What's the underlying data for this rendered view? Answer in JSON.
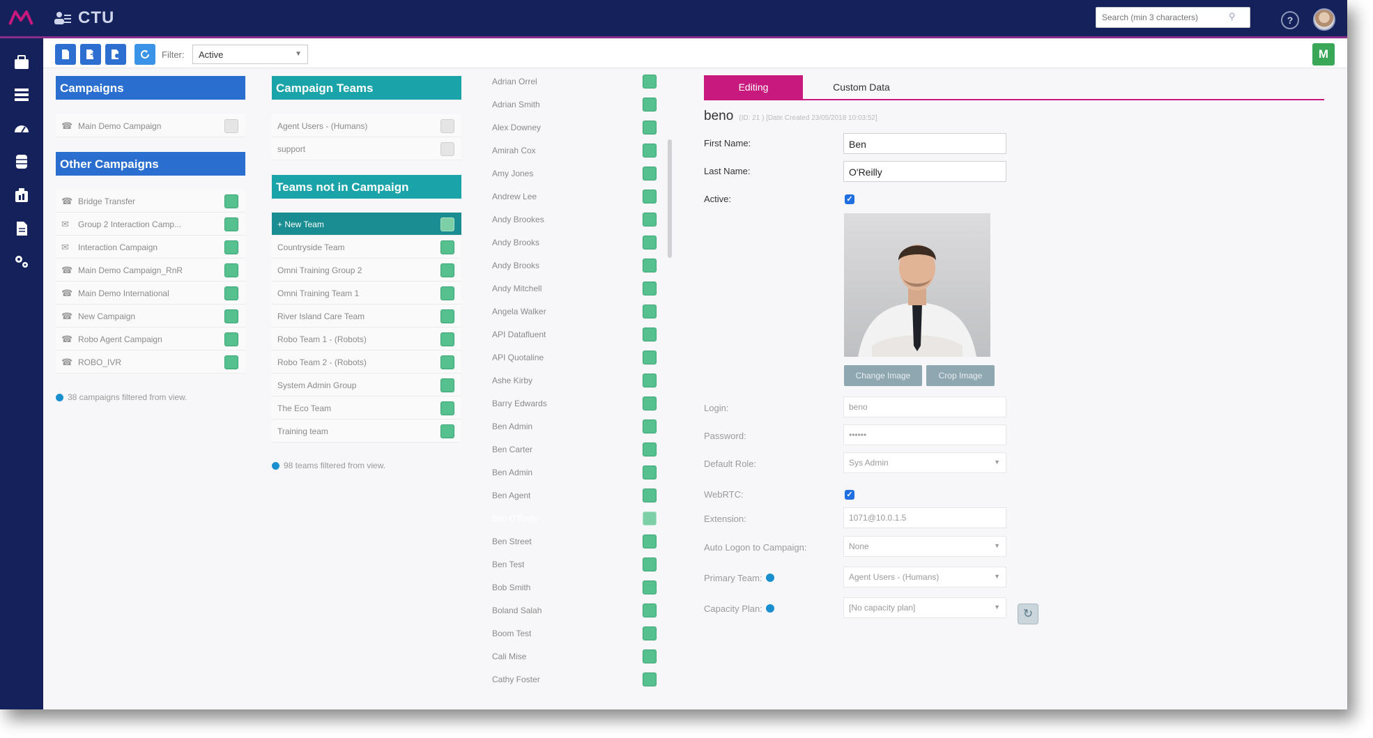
{
  "app": {
    "title": "CTU",
    "search_placeholder": "Search (min 3 characters)"
  },
  "toolbar": {
    "filter_label": "Filter:",
    "filter_value": "Active"
  },
  "campaigns": {
    "header": "Campaigns",
    "items": [
      {
        "label": "Main Demo Campaign",
        "icon": "phone-icon"
      }
    ]
  },
  "other_campaigns": {
    "header": "Other Campaigns",
    "items": [
      {
        "label": "Bridge Transfer",
        "icon": "phone-icon"
      },
      {
        "label": "Group 2 Interaction Camp...",
        "icon": "chat-icon"
      },
      {
        "label": "Interaction Campaign",
        "icon": "chat-icon"
      },
      {
        "label": "Main Demo Campaign_RnR",
        "icon": "phone-icon"
      },
      {
        "label": "Main Demo International",
        "icon": "phone-icon"
      },
      {
        "label": "New Campaign",
        "icon": "phone-icon"
      },
      {
        "label": "Robo Agent Campaign",
        "icon": "phone-icon"
      },
      {
        "label": "ROBO_IVR",
        "icon": "phone-icon"
      }
    ],
    "footnote": "38 campaigns filtered from view."
  },
  "campaign_teams": {
    "header": "Campaign Teams",
    "items": [
      {
        "label": "Agent Users - (Humans)"
      },
      {
        "label": "support"
      }
    ]
  },
  "teams_not_in_campaign": {
    "header": "Teams not in Campaign",
    "items": [
      {
        "label": "+ New Team"
      },
      {
        "label": "Countryside Team"
      },
      {
        "label": "Omni Training Group 2"
      },
      {
        "label": "Omni Training Team 1"
      },
      {
        "label": "River Island Care Team"
      },
      {
        "label": "Robo Team 1 - (Robots)"
      },
      {
        "label": "Robo Team 2 - (Robots)"
      },
      {
        "label": "System Admin Group"
      },
      {
        "label": "The Eco Team"
      },
      {
        "label": "Training team"
      }
    ],
    "footnote": "98 teams filtered from view."
  },
  "users": {
    "items": [
      {
        "label": "Adrian Orrel"
      },
      {
        "label": "Adrian Smith"
      },
      {
        "label": "Alex Downey"
      },
      {
        "label": "Amirah Cox"
      },
      {
        "label": "Amy Jones"
      },
      {
        "label": "Andrew Lee"
      },
      {
        "label": "Andy Brookes"
      },
      {
        "label": "Andy Brooks"
      },
      {
        "label": "Andy Brooks"
      },
      {
        "label": "Andy Mitchell"
      },
      {
        "label": "Angela Walker"
      },
      {
        "label": "API Datafluent"
      },
      {
        "label": "API Quotaline"
      },
      {
        "label": "Ashe Kirby"
      },
      {
        "label": "Barry Edwards"
      },
      {
        "label": "Ben Admin"
      },
      {
        "label": "Ben Carter"
      },
      {
        "label": "Ben Admin"
      },
      {
        "label": "Ben Agent"
      },
      {
        "label": "Ben O'Reilly"
      },
      {
        "label": "Ben Street"
      },
      {
        "label": "Ben Test"
      },
      {
        "label": "Bob Smith"
      },
      {
        "label": "Boland Salah"
      },
      {
        "label": "Boom Test"
      },
      {
        "label": "Cali Mise"
      },
      {
        "label": "Cathy Foster"
      },
      {
        "label": ""
      }
    ],
    "selected_index": 19
  },
  "form": {
    "tabs": {
      "editing": "Editing",
      "custom_data": "Custom Data"
    },
    "username": "beno",
    "meta": "(ID: 21 ) [Date Created 23/05/2018 10:03:52]",
    "first_name_label": "First Name:",
    "first_name_value": "Ben",
    "last_name_label": "Last Name:",
    "last_name_value": "O'Reilly",
    "active_label": "Active:",
    "change_image_label": "Change Image",
    "crop_image_label": "Crop Image",
    "login_label": "Login:",
    "login_value": "beno",
    "password_label": "Password:",
    "password_value": "••••••",
    "default_role_label": "Default Role:",
    "default_role_value": "Sys Admin",
    "webrtc_label": "WebRTC:",
    "extension_label": "Extension:",
    "extension_value": "1071@10.0.1.5",
    "auto_logon_label": "Auto Logon to Campaign:",
    "auto_logon_value": "None",
    "primary_team_label": "Primary Team:",
    "primary_team_value": "Agent Users - (Humans)",
    "capacity_plan_label": "Capacity Plan:",
    "capacity_plan_value": "[No capacity plan]"
  },
  "colors": {
    "topbar": "#15215a",
    "accent_magenta": "#c8197e",
    "header_blue": "#2a6fd0",
    "header_teal": "#1aa3a8",
    "add_green": "#56c18f"
  }
}
